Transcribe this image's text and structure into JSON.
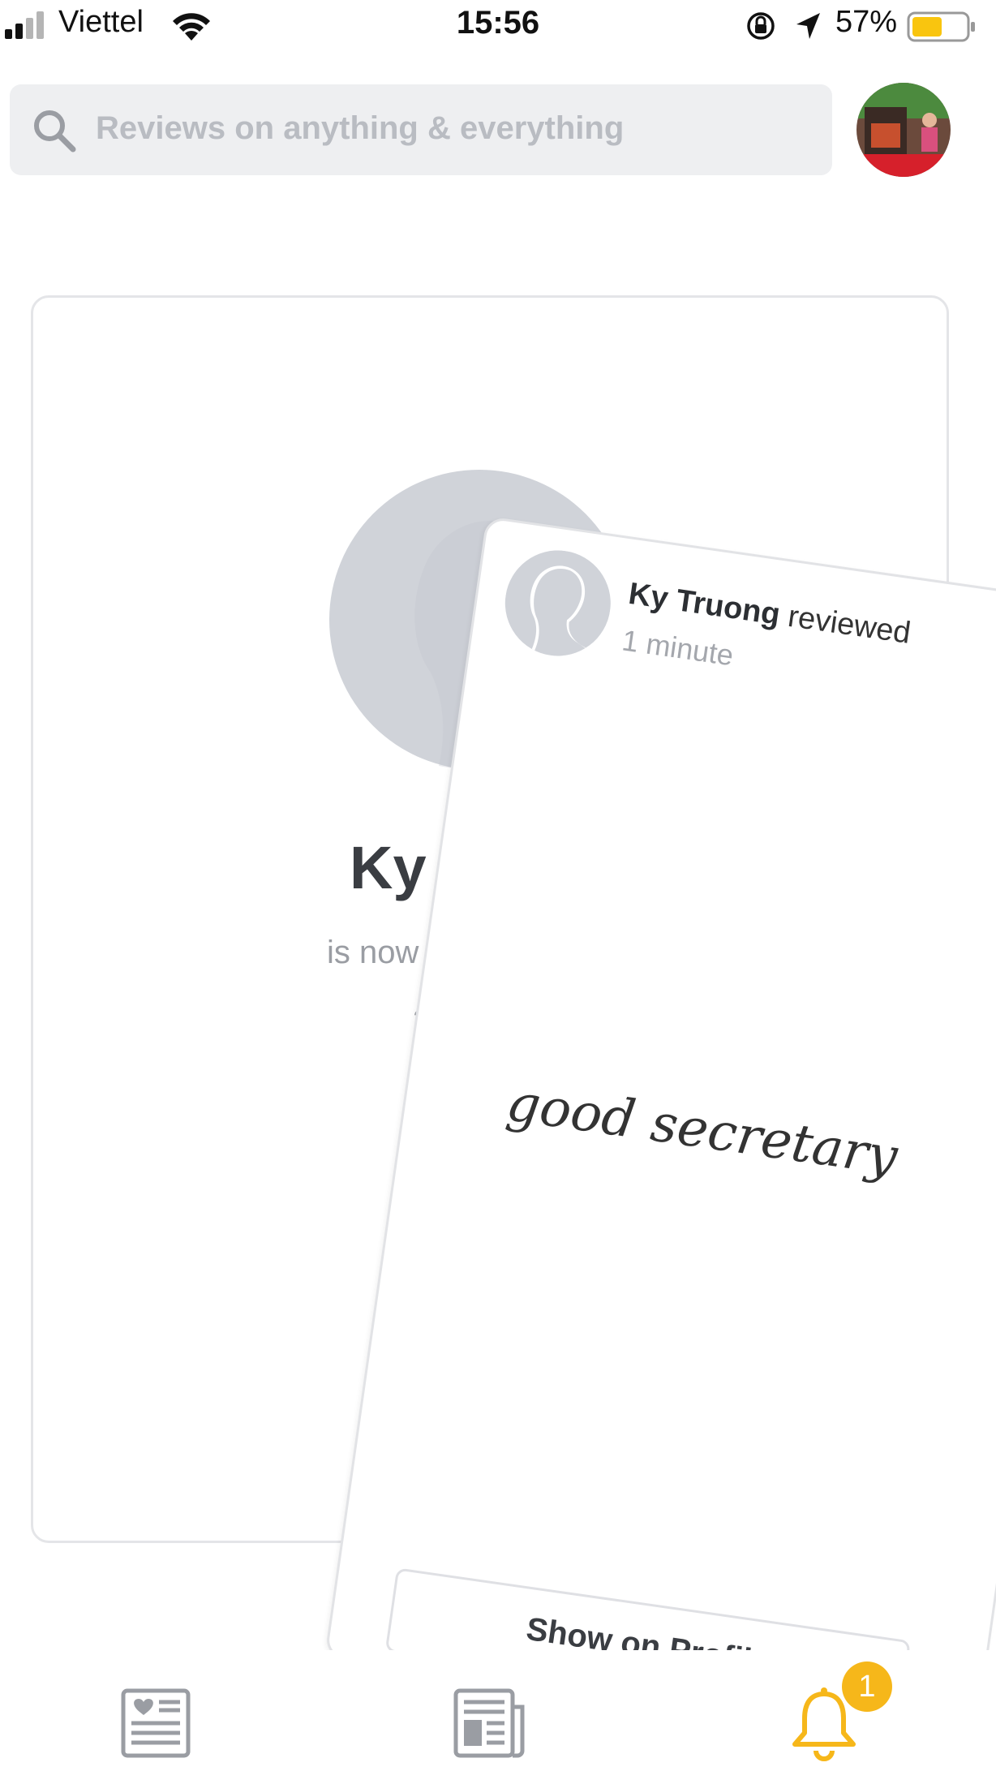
{
  "status_bar": {
    "carrier": "Viettel",
    "time": "15:56",
    "battery_percent": "57%",
    "battery_level": 0.57,
    "battery_color": "#f9c50f"
  },
  "search": {
    "placeholder": "Reviews on anything & everything"
  },
  "back_card": {
    "name": "Ky Tr",
    "subtitle": "is now fo",
    "time": "3 r"
  },
  "front_card": {
    "reviewer_name": "Ky Truong",
    "action": "reviewed",
    "time": "1 minute",
    "review_text": "good secretary",
    "button_label": "Show on Profile"
  },
  "tab_bar": {
    "tabs": [
      {
        "icon": "reviews-feed-icon"
      },
      {
        "icon": "newspaper-icon"
      },
      {
        "icon": "bell-icon"
      }
    ],
    "notification_badge": "1",
    "accent_color": "#f6b71a"
  },
  "colors": {
    "placeholder_gray": "#b9bcc2",
    "silhouette_gray": "#d0d3d9",
    "icon_gray": "#9a9da3"
  }
}
